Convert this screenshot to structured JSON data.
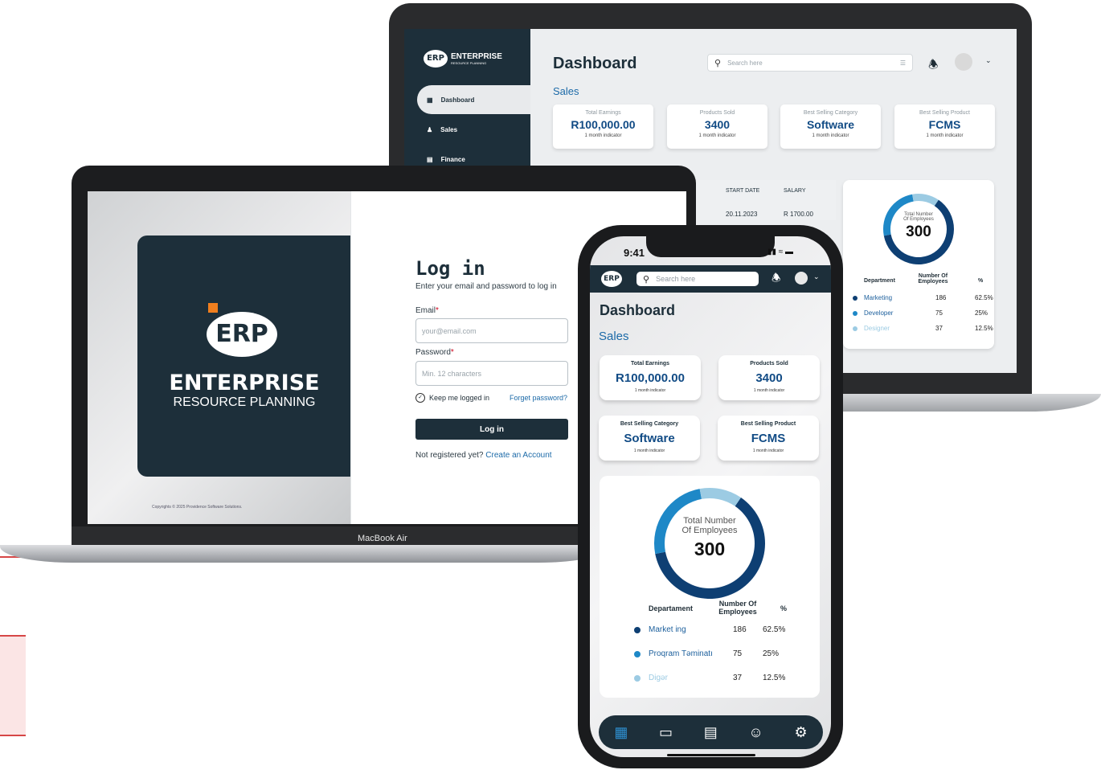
{
  "back_laptop": {
    "brand_main": "ENTERPRISE",
    "brand_sub": "RESOURCE PLANNING",
    "logo_text": "ERP",
    "nav": [
      {
        "label": "Dashboard",
        "icon": "grid-icon"
      },
      {
        "label": "Sales",
        "icon": "users-icon"
      },
      {
        "label": "Finance",
        "icon": "document-icon"
      }
    ],
    "title": "Dashboard",
    "search_placeholder": "Search here",
    "section": "Sales",
    "cards": [
      {
        "title": "Total Earnings",
        "value": "R100,000.00",
        "sub": "1 month indicator"
      },
      {
        "title": "Products Sold",
        "value": "3400",
        "sub": "1 month indicator"
      },
      {
        "title": "Best Selling Category",
        "value": "Software",
        "sub": "1 month indicator"
      },
      {
        "title": "Best Selling Product",
        "value": "FCMS",
        "sub": "1 month indicator"
      }
    ],
    "table": {
      "headers": [
        "START DATE",
        "SALARY"
      ],
      "row": [
        "20.11.2023",
        "R 1700.00"
      ]
    },
    "donut": {
      "label_line1": "Total Number",
      "label_line2": "Of Employees",
      "value": "300",
      "headers": [
        "Department",
        "Number Of Employees",
        "%"
      ],
      "rows": [
        {
          "name": "Marketing",
          "count": "186",
          "pct": "62.5%",
          "color": "#0e3f73"
        },
        {
          "name": "Developer",
          "count": "75",
          "pct": "25%",
          "color": "#1e88c7"
        },
        {
          "name": "Designer",
          "count": "37",
          "pct": "12.5%",
          "color": "#9ccbe3"
        }
      ]
    }
  },
  "login_laptop": {
    "logo_text": "ERP",
    "brand_main": "ENTERPRISE",
    "brand_sub": "RESOURCE PLANNING",
    "copyright": "Copyrights © 2025 Providence Software Solutions.",
    "title": "Log in",
    "subtitle": "Enter your email and password to log in",
    "email_label": "Email",
    "email_placeholder": "your@email.com",
    "password_label": "Password",
    "password_placeholder": "Min. 12 characters",
    "required_mark": "*",
    "keep_logged": "Keep me logged in",
    "forgot": "Forget password?",
    "login_button": "Log in",
    "not_registered": "Not registered yet?",
    "create_account": "Create an Account",
    "device_label": "MacBook Air"
  },
  "phone": {
    "time": "9:41",
    "logo_text": "ERP",
    "search_placeholder": "Search here",
    "title": "Dashboard",
    "section": "Sales",
    "cards": [
      {
        "title": "Total Earnings",
        "value": "R100,000.00",
        "sub": "1 month indicator"
      },
      {
        "title": "Products Sold",
        "value": "3400",
        "sub": "1 month indicator"
      },
      {
        "title": "Best Selling Category",
        "value": "Software",
        "sub": "1 month indicator"
      },
      {
        "title": "Best Selling Product",
        "value": "FCMS",
        "sub": "1 month indicator"
      }
    ],
    "donut": {
      "label_line1": "Total Number",
      "label_line2": "Of Employees",
      "value": "300",
      "headers": [
        "Departament",
        "Number Of Employees",
        "%"
      ],
      "rows": [
        {
          "name": "Market ing",
          "count": "186",
          "pct": "62.5%",
          "color": "#0e3f73"
        },
        {
          "name": "Proqram Təminatı",
          "count": "75",
          "pct": "25%",
          "color": "#1e88c7"
        },
        {
          "name": "Digər",
          "count": "37",
          "pct": "12.5%",
          "color": "#9ccbe3"
        }
      ]
    },
    "tabbar_icons": [
      "grid-icon",
      "monitor-icon",
      "chart-icon",
      "user-icon",
      "settings-icon"
    ]
  },
  "colors": {
    "navy": "#1d2f3a",
    "accent_orange": "#f07f1e",
    "link_blue": "#1c6aa8"
  }
}
